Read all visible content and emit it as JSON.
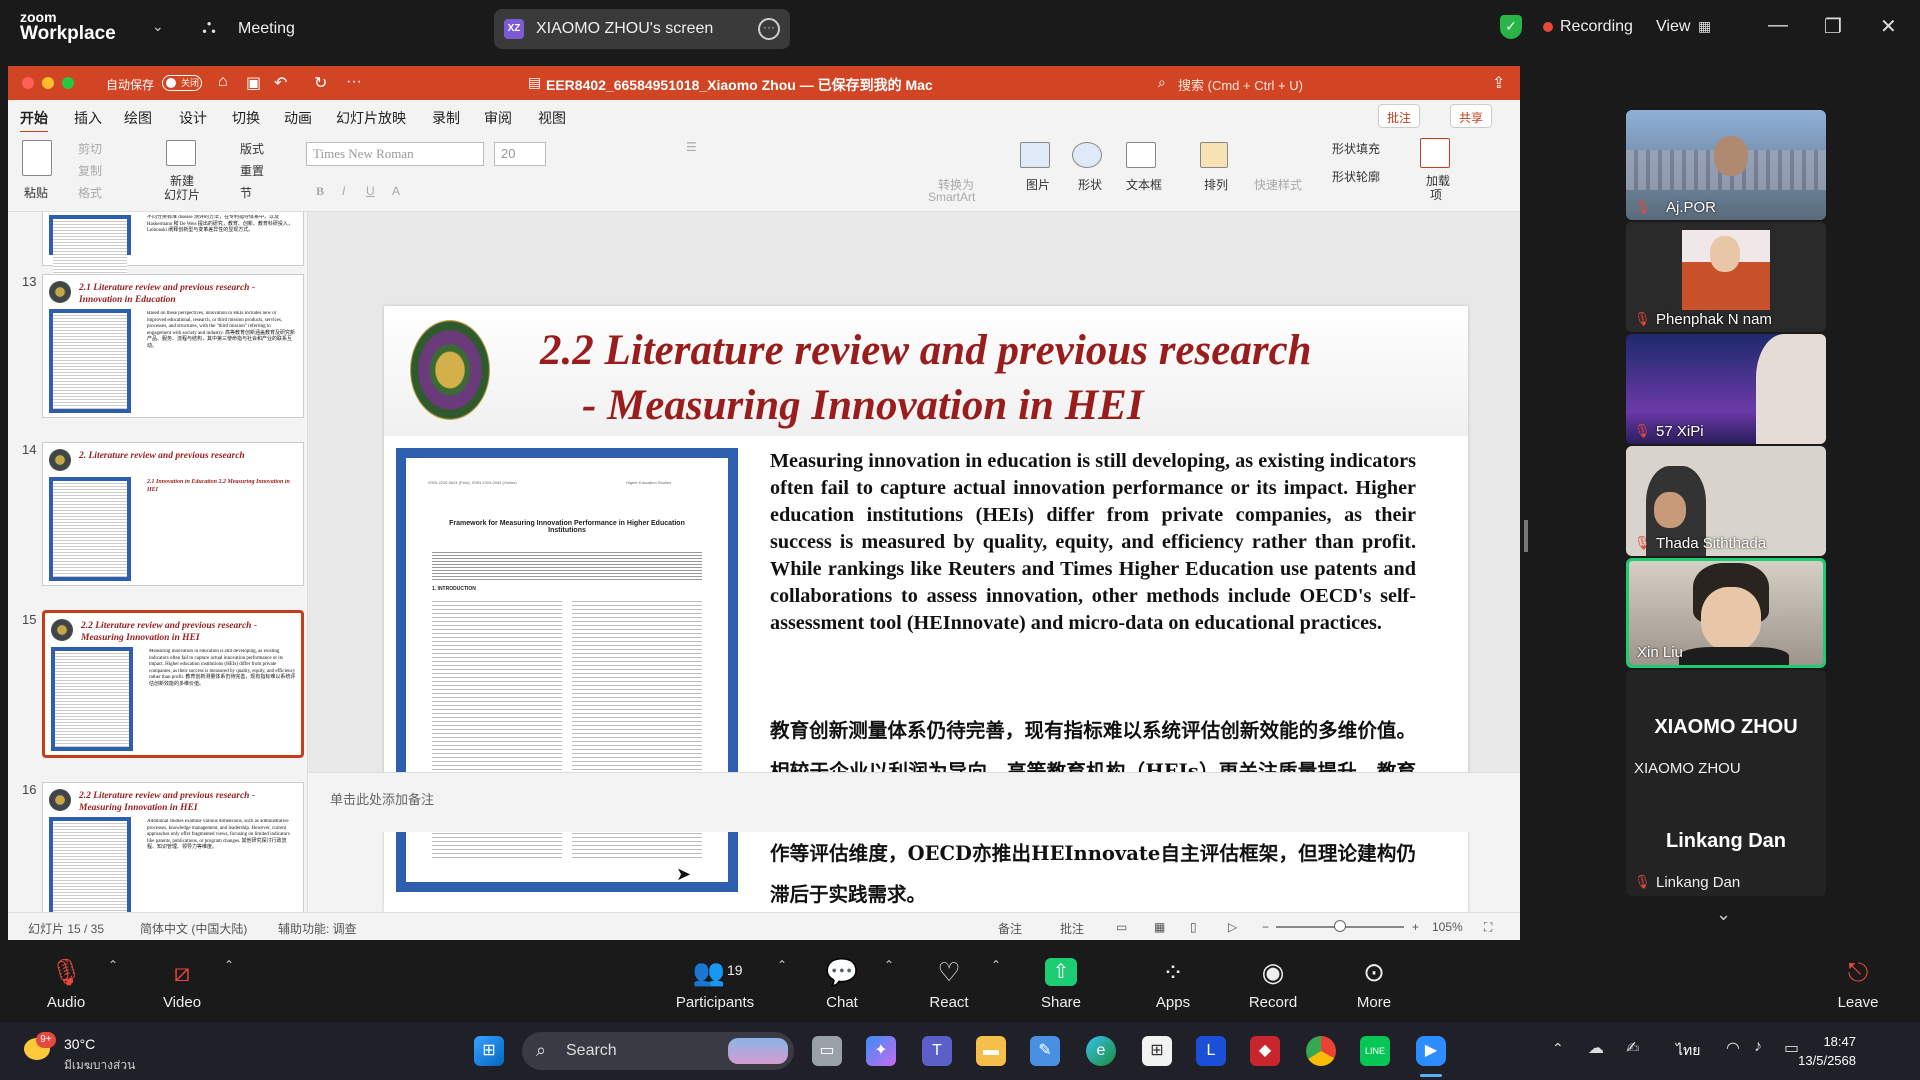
{
  "zoom": {
    "logo_line1": "zoom",
    "logo_line2": "Workplace",
    "meeting_label": "Meeting",
    "share_initials": "XZ",
    "share_label": "XIAOMO ZHOU's screen",
    "recording_label": "Recording",
    "view_label": "View"
  },
  "ppt": {
    "autosave_label": "自动保存",
    "autosave_state": "关闭",
    "doc_title": "EER8402_66584951018_Xiaomo Zhou — 已保存到我的 Mac",
    "search_placeholder": "搜索 (Cmd + Ctrl + U)",
    "tabs": [
      "开始",
      "插入",
      "绘图",
      "设计",
      "切换",
      "动画",
      "幻灯片放映",
      "录制",
      "审阅",
      "视图"
    ],
    "comments_button": "批注",
    "share_button": "共享",
    "ribbon": {
      "paste": "粘贴",
      "cut": "剪切",
      "copy": "复制",
      "format": "格式",
      "new_slide_1": "新建",
      "new_slide_2": "幻灯片",
      "layout": "版式",
      "reset": "重置",
      "section": "节",
      "font_name": "Times New Roman",
      "font_size": "20",
      "convert_smartart_1": "转换为",
      "convert_smartart_2": "SmartArt",
      "picture": "图片",
      "shape": "形状",
      "textbox": "文本框",
      "arrange": "排列",
      "quick_styles": "快速样式",
      "shape_fill": "形状填充",
      "shape_outline": "形状轮廓",
      "addins_1": "加载",
      "addins_2": "项"
    },
    "thumbnails": [
      {
        "num": "",
        "title": "",
        "body": "不同分类标准 disease 测评的方法，在专利指导体系中，以及 Haskermann 和 De Weis 提出的研究，教育、创新、教育科研投入，Leibonski 阐释创新型与变革差异性的显现方式。"
      },
      {
        "num": "13",
        "title": "2.1 Literature review and previous research - Innovation in Education",
        "body": "Based on these perspectives, innovation in HEIs includes new or improved educational, research, or third mission products, services, processes, and structures, with the \"third mission\" referring to engagement with society and industry. 高等教育创新涵盖教育及研究新产品、服务、流程与结构，其中第三使命指与社会和产业的联系互动。"
      },
      {
        "num": "14",
        "title": "2. Literature review and previous research",
        "body": "2.1 Innovation in Education\n2.2 Measuring Innovation in HEI"
      },
      {
        "num": "15",
        "title": "2.2 Literature review and previous research - Measuring Innovation in HEI",
        "body": "Measuring innovation in education is still developing, as existing indicators often fail to capture actual innovation performance or its impact. Higher education institutions (HEIs) differ from private companies, as their success is measured by quality, equity, and efficiency rather than profit. 教育创新测量体系仍待完善，现有指标难以系统评估创新效能的多维价值。"
      },
      {
        "num": "16",
        "title": "2.2 Literature review and previous research - Measuring Innovation in HEI",
        "body": "Additional studies examine various dimensions, such as administrative processes, knowledge management, and leadership. However, current approaches only offer fragmented views, focusing on limited indicators like patents, publications, or program changes. 其他研究探讨行政流程、知识管理、领导力等维度。"
      }
    ],
    "slide": {
      "title_line1": "2.2 Literature review and previous research",
      "title_line2": "- Measuring Innovation in HEI",
      "paper_header_left": "ISSN 2226-3624 (Print), ISSN 2303-0933 (Online)",
      "paper_header_right": "Higher Education Studies",
      "paper_title": "Framework for Measuring Innovation Performance in Higher Education Institutions",
      "paper_section": "1. INTRODUCTION",
      "body_en": "Measuring innovation in education is still developing, as existing indicators often fail to capture actual innovation performance or its impact. Higher education institutions (HEIs) differ from private companies, as their success is measured by quality, equity, and efficiency rather than profit. While rankings like Reuters and Times Higher Education use patents and collaborations to assess innovation, other methods include OECD's self-assessment tool (HEInnovate) and micro-data on educational practices.",
      "body_zh": "教育创新测量体系仍待完善，现有指标难以系统评估创新效能的多维价值。相较于企业以利润为导向，高等教育机构（HEIs）更关注质量提升、教育公平与资源效率的协同发展。当前路透社与THE排名虽构建专利与产学合作等评估维度，OECD亦推出HEInnovate自主评估框架，但理论建构仍滞后于实践需求。"
    },
    "notes_placeholder": "单击此处添加备注",
    "status": {
      "slide_counter": "幻灯片 15 / 35",
      "language": "简体中文 (中国大陆)",
      "accessibility": "辅助功能: 调查",
      "notes": "备注",
      "comments": "批注",
      "zoom_level": "105%"
    }
  },
  "participants": [
    {
      "name": "Aj.POR",
      "bg": "#6f8fb3"
    },
    {
      "name": "Phenphak N nam",
      "bg": "#c87a2f"
    },
    {
      "name": "57 XiPi",
      "bg": "#2a3c8f"
    },
    {
      "name": "Thada Siththada",
      "bg": "#d8d3cc"
    },
    {
      "name": "Xin Liu",
      "bg": "#c9c0b6"
    }
  ],
  "xiaomo": {
    "big": "XIAOMO ZHOU",
    "small": "XIAOMO ZHOU"
  },
  "linkang": {
    "big": "Linkang Dan",
    "small": "Linkang Dan"
  },
  "controls": {
    "audio": "Audio",
    "video": "Video",
    "participants": "Participants",
    "participants_count": "19",
    "chat": "Chat",
    "react": "React",
    "share": "Share",
    "apps": "Apps",
    "record": "Record",
    "more": "More",
    "leave": "Leave"
  },
  "taskbar": {
    "weather_badge": "9+",
    "temperature": "30°C",
    "weather_desc": "มีเมฆบางส่วน",
    "search": "Search",
    "lang": "ไทย",
    "time": "18:47",
    "date": "13/5/2568"
  },
  "colors": {
    "ppt_accent": "#c43e1c",
    "slide_title": "#9a1d1d",
    "zoom_green": "#1ecc74",
    "recording_red": "#e5483d"
  }
}
